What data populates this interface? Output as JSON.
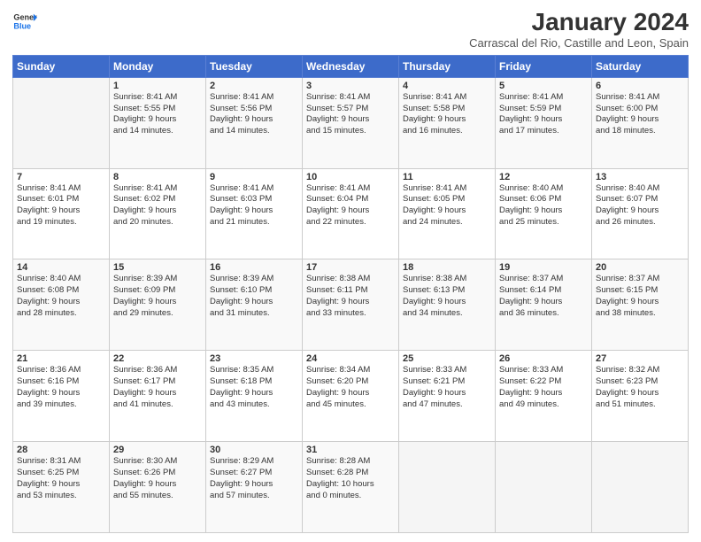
{
  "logo": {
    "line1": "General",
    "line2": "Blue"
  },
  "title": "January 2024",
  "subtitle": "Carrascal del Rio, Castille and Leon, Spain",
  "weekdays": [
    "Sunday",
    "Monday",
    "Tuesday",
    "Wednesday",
    "Thursday",
    "Friday",
    "Saturday"
  ],
  "weeks": [
    [
      {
        "day": "",
        "info": ""
      },
      {
        "day": "1",
        "info": "Sunrise: 8:41 AM\nSunset: 5:55 PM\nDaylight: 9 hours\nand 14 minutes."
      },
      {
        "day": "2",
        "info": "Sunrise: 8:41 AM\nSunset: 5:56 PM\nDaylight: 9 hours\nand 14 minutes."
      },
      {
        "day": "3",
        "info": "Sunrise: 8:41 AM\nSunset: 5:57 PM\nDaylight: 9 hours\nand 15 minutes."
      },
      {
        "day": "4",
        "info": "Sunrise: 8:41 AM\nSunset: 5:58 PM\nDaylight: 9 hours\nand 16 minutes."
      },
      {
        "day": "5",
        "info": "Sunrise: 8:41 AM\nSunset: 5:59 PM\nDaylight: 9 hours\nand 17 minutes."
      },
      {
        "day": "6",
        "info": "Sunrise: 8:41 AM\nSunset: 6:00 PM\nDaylight: 9 hours\nand 18 minutes."
      }
    ],
    [
      {
        "day": "7",
        "info": "Sunrise: 8:41 AM\nSunset: 6:01 PM\nDaylight: 9 hours\nand 19 minutes."
      },
      {
        "day": "8",
        "info": "Sunrise: 8:41 AM\nSunset: 6:02 PM\nDaylight: 9 hours\nand 20 minutes."
      },
      {
        "day": "9",
        "info": "Sunrise: 8:41 AM\nSunset: 6:03 PM\nDaylight: 9 hours\nand 21 minutes."
      },
      {
        "day": "10",
        "info": "Sunrise: 8:41 AM\nSunset: 6:04 PM\nDaylight: 9 hours\nand 22 minutes."
      },
      {
        "day": "11",
        "info": "Sunrise: 8:41 AM\nSunset: 6:05 PM\nDaylight: 9 hours\nand 24 minutes."
      },
      {
        "day": "12",
        "info": "Sunrise: 8:40 AM\nSunset: 6:06 PM\nDaylight: 9 hours\nand 25 minutes."
      },
      {
        "day": "13",
        "info": "Sunrise: 8:40 AM\nSunset: 6:07 PM\nDaylight: 9 hours\nand 26 minutes."
      }
    ],
    [
      {
        "day": "14",
        "info": "Sunrise: 8:40 AM\nSunset: 6:08 PM\nDaylight: 9 hours\nand 28 minutes."
      },
      {
        "day": "15",
        "info": "Sunrise: 8:39 AM\nSunset: 6:09 PM\nDaylight: 9 hours\nand 29 minutes."
      },
      {
        "day": "16",
        "info": "Sunrise: 8:39 AM\nSunset: 6:10 PM\nDaylight: 9 hours\nand 31 minutes."
      },
      {
        "day": "17",
        "info": "Sunrise: 8:38 AM\nSunset: 6:11 PM\nDaylight: 9 hours\nand 33 minutes."
      },
      {
        "day": "18",
        "info": "Sunrise: 8:38 AM\nSunset: 6:13 PM\nDaylight: 9 hours\nand 34 minutes."
      },
      {
        "day": "19",
        "info": "Sunrise: 8:37 AM\nSunset: 6:14 PM\nDaylight: 9 hours\nand 36 minutes."
      },
      {
        "day": "20",
        "info": "Sunrise: 8:37 AM\nSunset: 6:15 PM\nDaylight: 9 hours\nand 38 minutes."
      }
    ],
    [
      {
        "day": "21",
        "info": "Sunrise: 8:36 AM\nSunset: 6:16 PM\nDaylight: 9 hours\nand 39 minutes."
      },
      {
        "day": "22",
        "info": "Sunrise: 8:36 AM\nSunset: 6:17 PM\nDaylight: 9 hours\nand 41 minutes."
      },
      {
        "day": "23",
        "info": "Sunrise: 8:35 AM\nSunset: 6:18 PM\nDaylight: 9 hours\nand 43 minutes."
      },
      {
        "day": "24",
        "info": "Sunrise: 8:34 AM\nSunset: 6:20 PM\nDaylight: 9 hours\nand 45 minutes."
      },
      {
        "day": "25",
        "info": "Sunrise: 8:33 AM\nSunset: 6:21 PM\nDaylight: 9 hours\nand 47 minutes."
      },
      {
        "day": "26",
        "info": "Sunrise: 8:33 AM\nSunset: 6:22 PM\nDaylight: 9 hours\nand 49 minutes."
      },
      {
        "day": "27",
        "info": "Sunrise: 8:32 AM\nSunset: 6:23 PM\nDaylight: 9 hours\nand 51 minutes."
      }
    ],
    [
      {
        "day": "28",
        "info": "Sunrise: 8:31 AM\nSunset: 6:25 PM\nDaylight: 9 hours\nand 53 minutes."
      },
      {
        "day": "29",
        "info": "Sunrise: 8:30 AM\nSunset: 6:26 PM\nDaylight: 9 hours\nand 55 minutes."
      },
      {
        "day": "30",
        "info": "Sunrise: 8:29 AM\nSunset: 6:27 PM\nDaylight: 9 hours\nand 57 minutes."
      },
      {
        "day": "31",
        "info": "Sunrise: 8:28 AM\nSunset: 6:28 PM\nDaylight: 10 hours\nand 0 minutes."
      },
      {
        "day": "",
        "info": ""
      },
      {
        "day": "",
        "info": ""
      },
      {
        "day": "",
        "info": ""
      }
    ]
  ]
}
